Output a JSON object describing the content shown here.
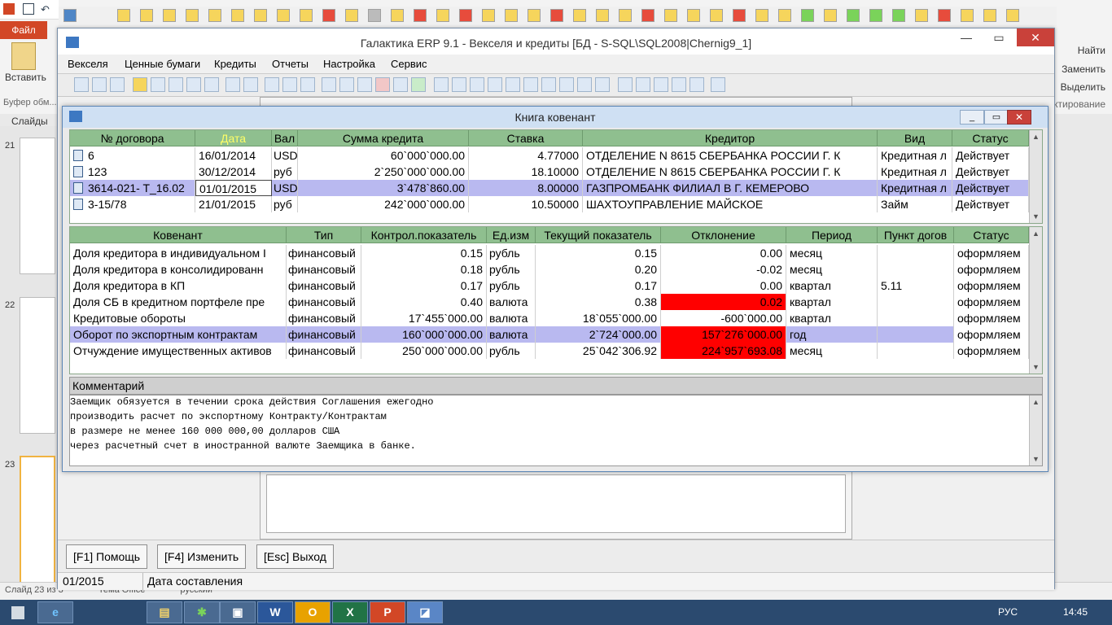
{
  "ppt": {
    "file_tab": "Файл",
    "paste_label": "Вставить",
    "clipboard_label": "Буфер обм...",
    "slides_label": "Слайды",
    "right_find": "Найти",
    "right_replace": "Заменить",
    "right_select": "Выделить",
    "right_editing": "ктирование",
    "thumb_numbers": [
      "21",
      "22",
      "23"
    ],
    "status_left": "Слайд 23 из 3",
    "status_theme": "Тема Office",
    "status_lang": "русский"
  },
  "taskbar": {
    "apps": [
      "W",
      "O",
      "X",
      "P"
    ],
    "lang": "РУС",
    "time": "14:45"
  },
  "erp": {
    "title": "Галактика ERP 9.1 - Векселя и кредиты [БД - S-SQL\\SQL2008|Chernig9_1]",
    "menu": [
      "Векселя",
      "Ценные бумаги",
      "Кредиты",
      "Отчеты",
      "Настройка",
      "Сервис"
    ],
    "buttons": {
      "help": "[F1] Помощь",
      "edit": "[F4] Изменить",
      "exit": "[Esc] Выход"
    },
    "status": {
      "value": "01/2015",
      "label": "Дата составления"
    }
  },
  "dialog": {
    "title": "Книга ковенант",
    "contracts": {
      "headers": [
        "№ договора",
        "Дата",
        "Вал",
        "Сумма кредита",
        "Ставка",
        "Кредитор",
        "Вид",
        "Статус"
      ],
      "rows": [
        {
          "num": "6",
          "date": "16/01/2014",
          "cur": "USD",
          "sum": "60`000`000.00",
          "rate": "4.77000",
          "creditor": "ОТДЕЛЕНИЕ N 8615 СБЕРБАНКА РОССИИ Г. К",
          "kind": "Кредитная л",
          "status": "Действует"
        },
        {
          "num": "123",
          "date": "30/12/2014",
          "cur": "руб",
          "sum": "2`250`000`000.00",
          "rate": "18.10000",
          "creditor": "ОТДЕЛЕНИЕ N 8615 СБЕРБАНКА РОССИИ Г. К",
          "kind": "Кредитная л",
          "status": "Действует"
        },
        {
          "num": "3614-021- T_16.02",
          "date": "01/01/2015",
          "cur": "USD",
          "sum": "3`478`860.00",
          "rate": "8.00000",
          "creditor": "ГАЗПРОМБАНК  ФИЛИАЛ В Г. КЕМЕРОВО",
          "kind": "Кредитная л",
          "status": "Действует"
        },
        {
          "num": "3-15/78",
          "date": "21/01/2015",
          "cur": "руб",
          "sum": "242`000`000.00",
          "rate": "10.50000",
          "creditor": "ШАХТОУПРАВЛЕНИЕ МАЙСКОЕ",
          "kind": "Займ",
          "status": "Действует"
        }
      ]
    },
    "covenants": {
      "headers": [
        "Ковенант",
        "Тип",
        "Контрол.показатель",
        "Ед.изм",
        "Текущий показатель",
        "Отклонение",
        "Период",
        "Пункт догов",
        "Статус"
      ],
      "rows": [
        {
          "name": "Доля кредитора в индивидуальном I",
          "type": "финансовый",
          "ctrl": "0.15",
          "unit": "рубль",
          "cur": "0.15",
          "dev": "0.00",
          "period": "месяц",
          "clause": "",
          "status": "оформляем"
        },
        {
          "name": "Доля кредитора в консолидированн",
          "type": "финансовый",
          "ctrl": "0.18",
          "unit": "рубль",
          "cur": "0.20",
          "dev": "-0.02",
          "period": "месяц",
          "clause": "",
          "status": "оформляем"
        },
        {
          "name": "Доля кредитора в КП",
          "type": "финансовый",
          "ctrl": "0.17",
          "unit": "рубль",
          "cur": "0.17",
          "dev": "0.00",
          "period": "квартал",
          "clause": "5.11",
          "status": "оформляем"
        },
        {
          "name": "Доля СБ в кредитном портфеле пре",
          "type": "финансовый",
          "ctrl": "0.40",
          "unit": "валюта",
          "cur": "0.38",
          "dev": "0.02",
          "period": "квартал",
          "clause": "",
          "status": "оформляем"
        },
        {
          "name": "Кредитовые обороты",
          "type": "финансовый",
          "ctrl": "17`455`000.00",
          "unit": "валюта",
          "cur": "18`055`000.00",
          "dev": "-600`000.00",
          "period": "квартал",
          "clause": "",
          "status": "оформляем"
        },
        {
          "name": "Оборот по экспортным контрактам",
          "type": "финансовый",
          "ctrl": "160`000`000.00",
          "unit": "валюта",
          "cur": "2`724`000.00",
          "dev": "157`276`000.00",
          "period": "год",
          "clause": "",
          "status": "оформляем"
        },
        {
          "name": "Отчуждение имущественных активов",
          "type": "финансовый",
          "ctrl": "250`000`000.00",
          "unit": "рубль",
          "cur": "25`042`306.92",
          "dev": "224`957`693.08",
          "period": "месяц",
          "clause": "",
          "status": "оформляем"
        }
      ]
    },
    "comment": {
      "header": "Комментарий",
      "lines": [
        "Заемщик обязуется в течении срока действия Соглашения ежегодно",
        "производить расчет по экспортному Контракту/Контрактам",
        "в размере не менее 160 000 000,00 долларов США",
        "через расчетный счет в иностранной валюте Заемщика в банке."
      ]
    }
  },
  "colors": {
    "grid_header": "#8fbf8f",
    "selected_row": "#b9b9f0",
    "alert": "#ff0000",
    "date_header": "#ffff66"
  }
}
